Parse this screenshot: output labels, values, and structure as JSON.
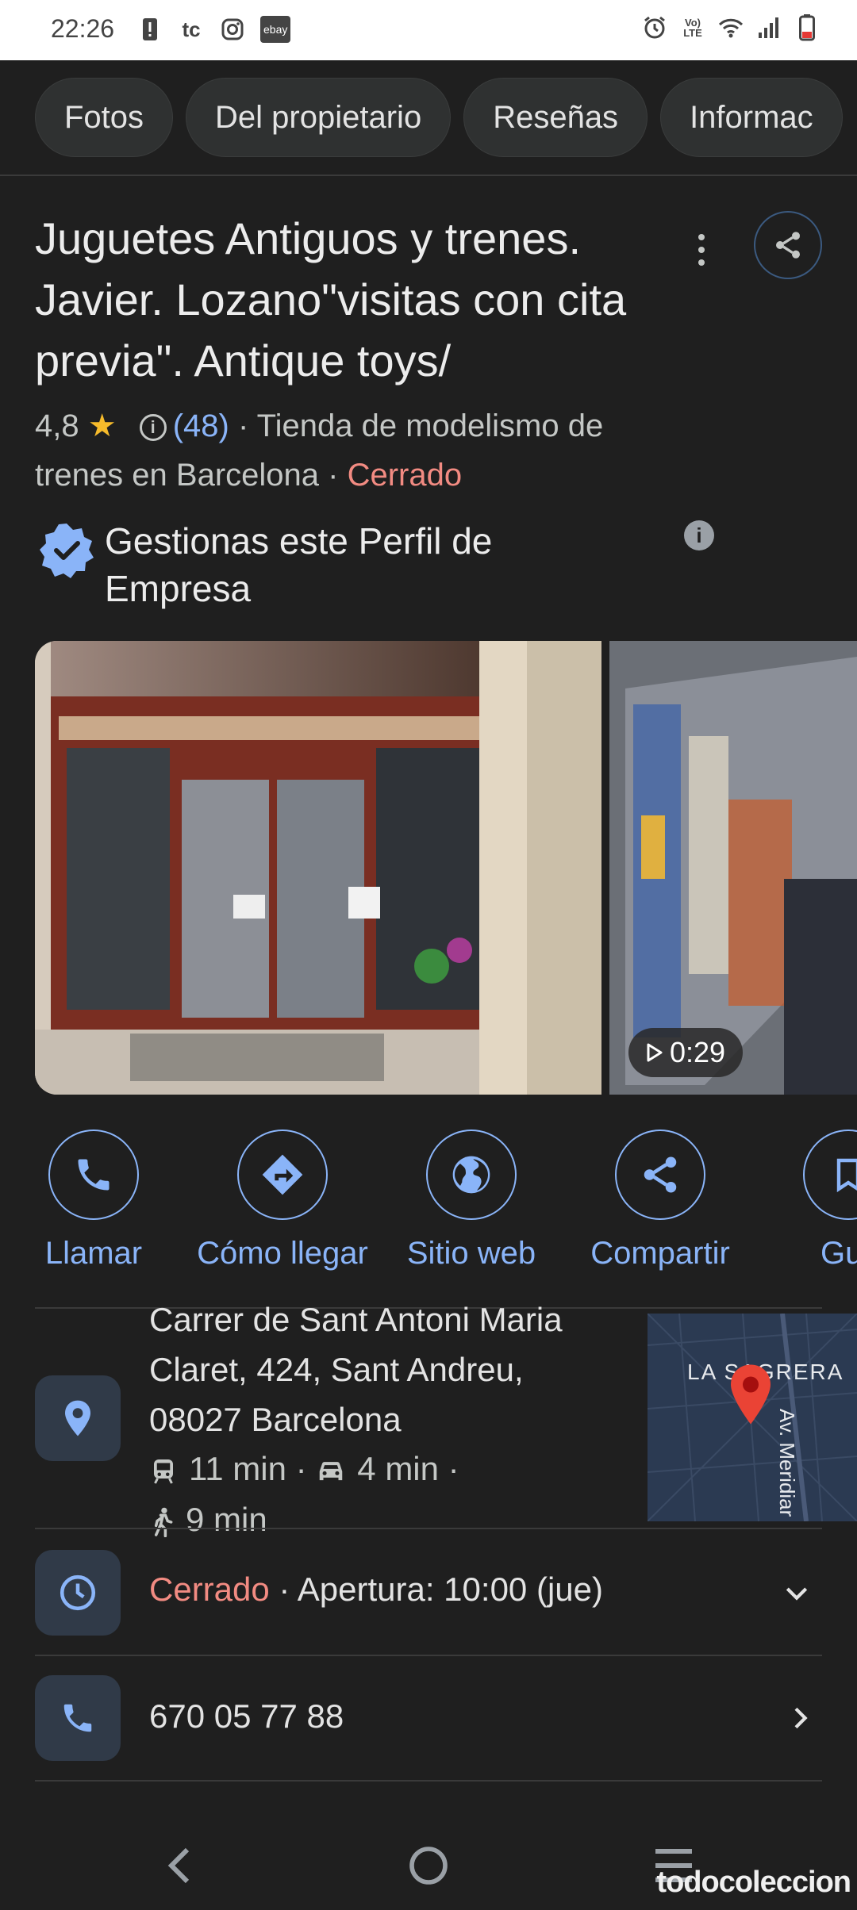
{
  "status_bar": {
    "time": "22:26",
    "left_icons": [
      "alert-icon",
      "tc-icon",
      "instagram-icon",
      "ebay-icon"
    ],
    "ebay_text": "ebay",
    "tc_text": "tc",
    "right_icons": [
      "alarm-icon",
      "volte-icon",
      "wifi-icon",
      "signal-icon",
      "battery-icon"
    ],
    "volte_text": "Vo) LTE"
  },
  "chips": [
    {
      "label": "Fotos"
    },
    {
      "label": "Del propietario"
    },
    {
      "label": "Reseñas"
    },
    {
      "label": "Informac"
    }
  ],
  "place": {
    "title": "Juguetes Antiguos y trenes. Javier. Lozano\"visitas con cita previa\". Antique toys/",
    "rating": "4,8",
    "star": "★",
    "review_count": "(48)",
    "category": " · Tienda de modelismo de trenes en Barcelona · ",
    "status": "Cerrado"
  },
  "owner_notice": {
    "text": "Gestionas este Perfil de Empresa"
  },
  "photos": {
    "video_duration": "0:29"
  },
  "actions": [
    {
      "label": "Llamar",
      "icon": "phone-icon"
    },
    {
      "label": "Cómo llegar",
      "icon": "directions-icon"
    },
    {
      "label": "Sitio web",
      "icon": "globe-icon"
    },
    {
      "label": "Compartir",
      "icon": "share-icon"
    },
    {
      "label": "Guar",
      "icon": "bookmark-icon"
    }
  ],
  "address": {
    "text": "Carrer de Sant Antoni Maria Claret, 424, Sant Andreu, 08027 Barcelona",
    "transit_time": "11 min",
    "drive_time": "4 min",
    "walk_time": "9 min",
    "separator": "·"
  },
  "map": {
    "area_label": "LA SAGRERA",
    "street_label": "Av. Meridiar"
  },
  "hours": {
    "status": "Cerrado",
    "detail": " · Apertura: 10:00 (jue)"
  },
  "phone": {
    "number": "670 05 77 88"
  },
  "watermark": "todocoleccion",
  "colors": {
    "background": "#1f1f1f",
    "accent_blue": "#8ab4f8",
    "closed_red": "#f28b82",
    "star_yellow": "#f6bb2b"
  }
}
